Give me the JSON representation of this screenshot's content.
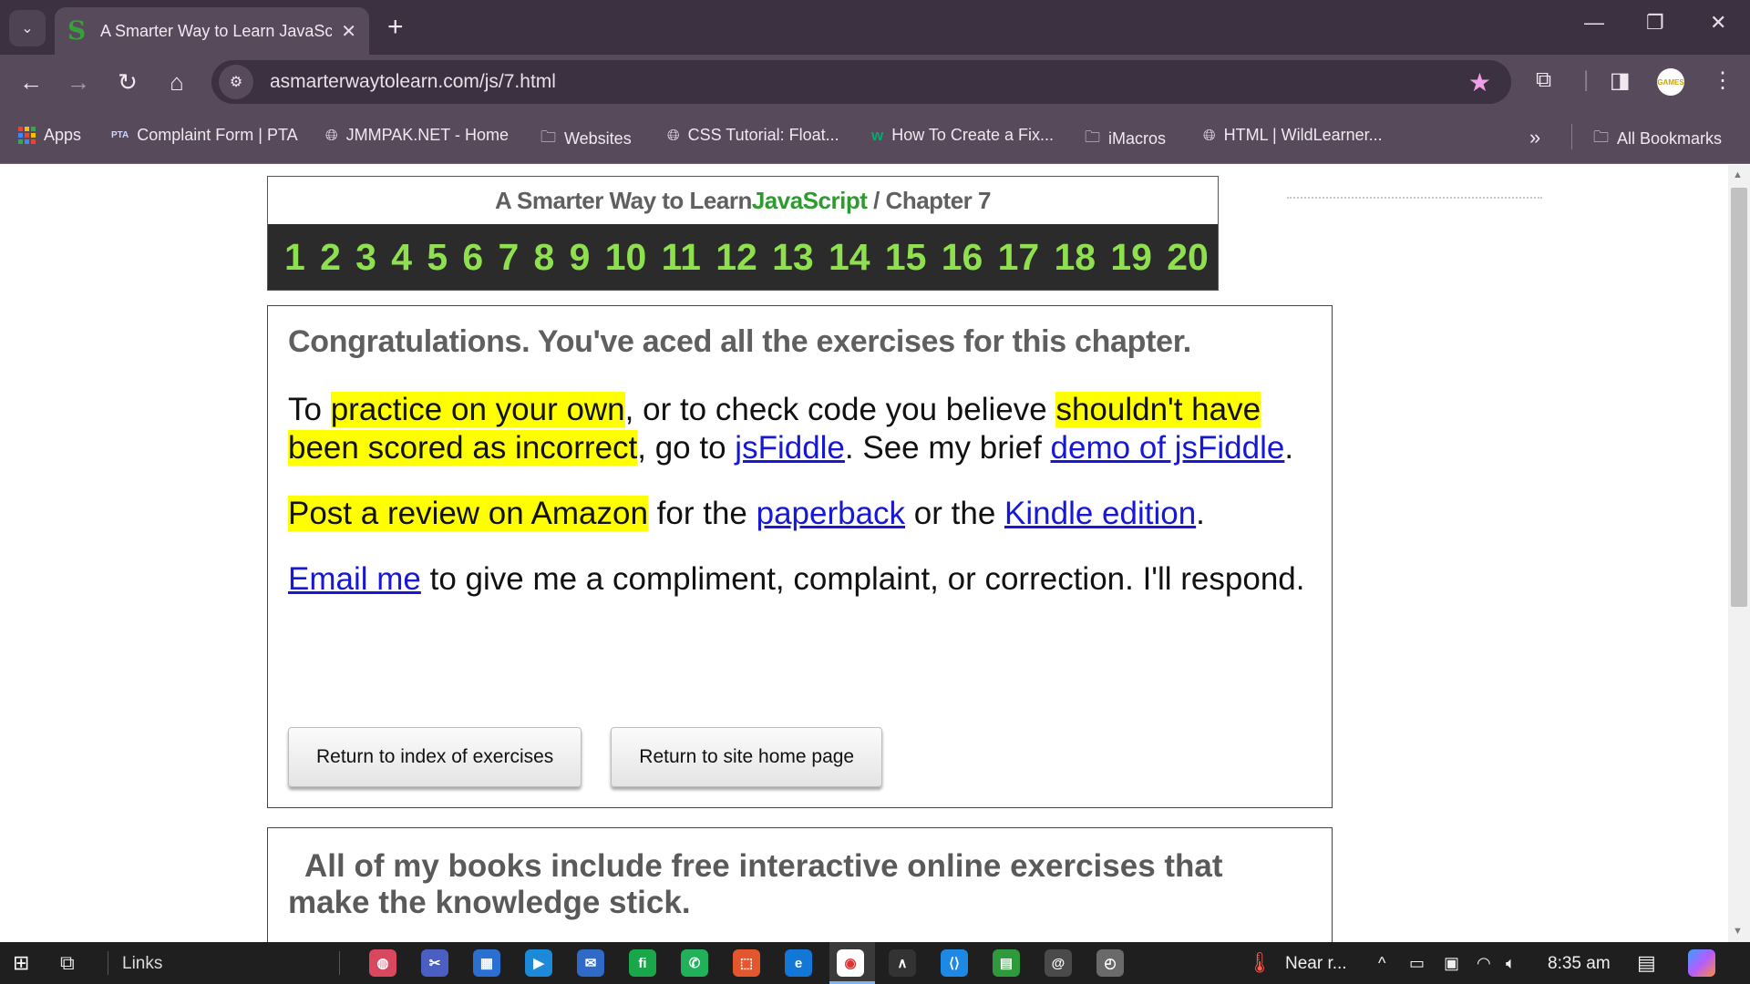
{
  "browser": {
    "tab_title": "A Smarter Way to Learn JavaScr",
    "favicon_letter": "S",
    "url": "asmarterwaytolearn.com/js/7.html",
    "profile_badge": "GAMES"
  },
  "bookmarks": [
    {
      "label": "Apps",
      "icon": "apps-grid-icon"
    },
    {
      "label": "Complaint Form | PTA",
      "icon": "pta-logo-icon"
    },
    {
      "label": "JMMPAK.NET - Home",
      "icon": "globe-icon"
    },
    {
      "label": "Websites",
      "icon": "folder-icon"
    },
    {
      "label": "CSS Tutorial: Float...",
      "icon": "globe-icon"
    },
    {
      "label": "How To Create a Fix...",
      "icon": "w3schools-icon"
    },
    {
      "label": "iMacros",
      "icon": "folder-icon"
    },
    {
      "label": "HTML | WildLearner...",
      "icon": "globe-icon"
    }
  ],
  "all_bookmarks": "All Bookmarks",
  "page": {
    "header_prefix": "A Smarter Way to Learn ",
    "header_js": "JavaScript",
    "header_suffix": " / Chapter 7",
    "chapters": [
      "1",
      "2",
      "3",
      "4",
      "5",
      "6",
      "7",
      "8",
      "9",
      "10",
      "11",
      "12",
      "13",
      "14",
      "15",
      "16",
      "17",
      "18",
      "19",
      "20"
    ],
    "congrats": "Congratulations. You've aced all the exercises for this chapter.",
    "p1": {
      "t1": "To ",
      "hl1": "practice on your own",
      "t2": ", or to check code you believe ",
      "hl2": "shouldn't have been scored as incorrect",
      "t3": ", go to ",
      "link1": "jsFiddle",
      "t4": ". See my brief ",
      "link2": "demo of jsFiddle",
      "t5": "."
    },
    "p2": {
      "hl": "Post a review on Amazon",
      "t1": " for the ",
      "link1": "paperback",
      "t2": " or the ",
      "link2": "Kindle edition",
      "t3": "."
    },
    "p3": {
      "link": "Email me",
      "text": " to give me a compliment, complaint, or correction. I'll respond."
    },
    "button_index": "Return to index of exercises",
    "button_home": "Return to site home page",
    "books_text": "All of my books include free interactive online exercises that make the knowledge stick."
  },
  "taskbar": {
    "links_label": "Links",
    "weather": "Near r...",
    "time": "8:35 am",
    "apps": [
      "paint-icon",
      "snip-icon",
      "store-icon",
      "terminal-icon",
      "mail-icon",
      "fiverr-icon",
      "whatsapp-icon",
      "office-icon",
      "edge-icon",
      "chrome-icon",
      "arduino-icon",
      "vscode-icon",
      "chip-icon",
      "tor-icon",
      "clock-icon"
    ]
  },
  "colors": {
    "chrome_dark": "#3c3140",
    "chrome_mid": "#574a5b",
    "chapter_bg": "#2b2b2b",
    "chapter_green": "#8fe04f",
    "highlight": "#ffff00",
    "link": "#1717d6"
  }
}
